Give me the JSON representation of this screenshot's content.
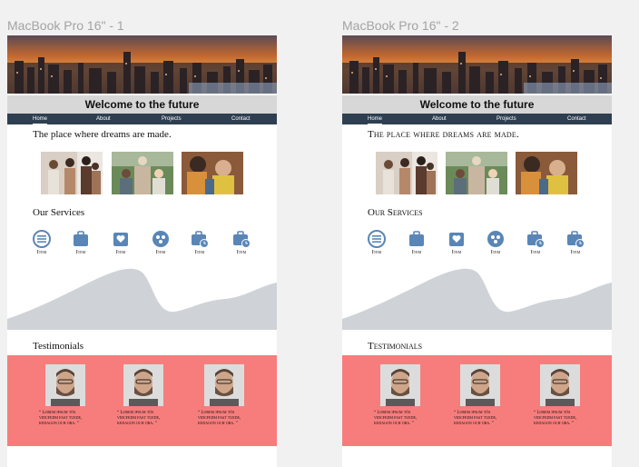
{
  "frames": [
    {
      "title": "MacBook Pro 16\" - 1",
      "welcome": "Welcome to the future",
      "nav": [
        "Home",
        "About",
        "Projects",
        "Contact"
      ],
      "tagline": "The place where dreams are made.",
      "services_title": "Our Services",
      "services": [
        "Item",
        "Item",
        "Item",
        "Item",
        "Item",
        "Item"
      ],
      "testimonials_title": "Testimonials",
      "testimonials": [
        "Lorem ipsum tös vidcfedm fast tuede, kedagon och ora.",
        "Lorem ipsum tös vidcfedm fast tuede, kedagon och ora.",
        "Lorem ipsum tös vidcfedm fast tuede, kedagon och ora."
      ]
    },
    {
      "title": "MacBook Pro 16\" - 2",
      "welcome": "Welcome to the future",
      "nav": [
        "Home",
        "About",
        "Projects",
        "Contact"
      ],
      "tagline": "The place where dreams are made.",
      "services_title": "Our Services",
      "services": [
        "Item",
        "Item",
        "Item",
        "Item",
        "Item",
        "Item"
      ],
      "testimonials_title": "Testimonials",
      "testimonials": [
        "Lorem ipsum tös vidcfedm fast tuede, kedagon och ora.",
        "Lorem ipsum tös vidcfedm fast tuede, kedagon och ora.",
        "Lorem ipsum tös vidcfedm fast tuede, kedagon och ora."
      ]
    }
  ],
  "service_icons": [
    "menu-circle-icon",
    "briefcase-icon",
    "heart-hands-icon",
    "group-circle-icon",
    "briefcase-clock-icon",
    "briefcase-clock-icon"
  ],
  "colors": {
    "nav_bg": "#2e3f52",
    "icon_blue": "#5a86b6",
    "wave_gray": "#cfd2d6",
    "testimonial_bg": "#f77d7d",
    "welcome_bar": "#d7d7d7"
  }
}
